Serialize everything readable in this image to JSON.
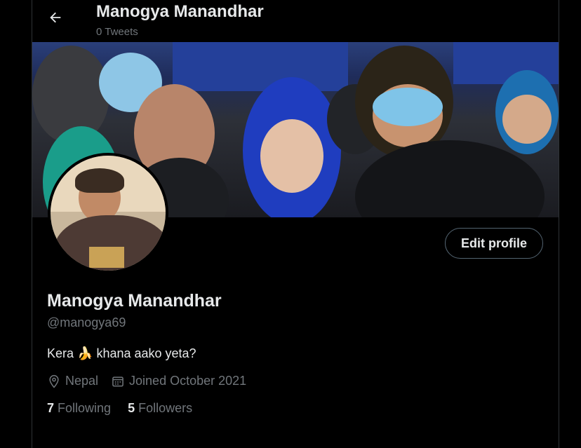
{
  "header": {
    "back_label": "Back",
    "name": "Manogya Manandhar",
    "tweet_count": "0 Tweets"
  },
  "banner": {
    "description_icon": "photo-banner"
  },
  "actions": {
    "edit_profile": "Edit profile"
  },
  "profile": {
    "name": "Manogya Manandhar",
    "handle": "@manogya69",
    "bio_before": "Kera ",
    "bio_emoji": "🍌",
    "bio_after": " khana aako yeta?",
    "location": "Nepal",
    "joined": "Joined October 2021"
  },
  "stats": {
    "following_count": "7",
    "following_label": "Following",
    "followers_count": "5",
    "followers_label": "Followers"
  },
  "colors": {
    "background": "#000000",
    "text": "#e7e9ea",
    "muted": "#71767b",
    "border": "#2f3336"
  }
}
